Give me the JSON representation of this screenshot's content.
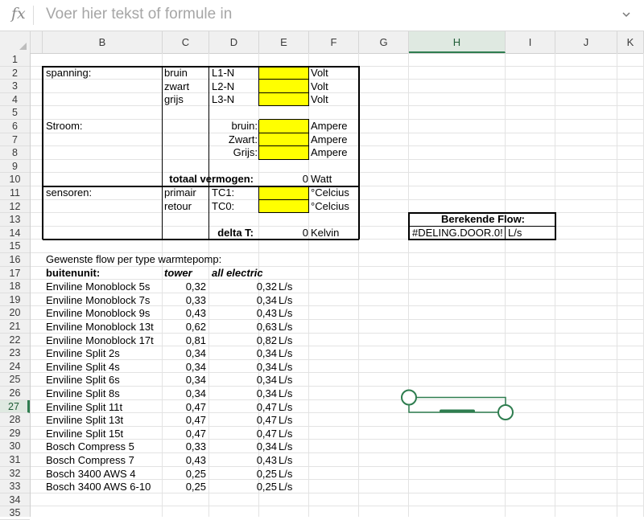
{
  "formula_bar": {
    "fx_label": "fx",
    "placeholder": "Voer hier tekst of formule in"
  },
  "columns": [
    "B",
    "C",
    "D",
    "E",
    "F",
    "G",
    "H",
    "I",
    "J",
    "K"
  ],
  "selected_column": "H",
  "selected_row": 27,
  "rows": [
    "1",
    "2",
    "3",
    "4",
    "5",
    "6",
    "7",
    "8",
    "9",
    "10",
    "11",
    "12",
    "13",
    "14",
    "15",
    "16",
    "17",
    "18",
    "19",
    "20",
    "21",
    "22",
    "23",
    "24",
    "25",
    "26",
    "27",
    "28",
    "29",
    "30",
    "31",
    "32",
    "33",
    "34",
    "35"
  ],
  "block": {
    "spanning": "spanning:",
    "bruin": "bruin",
    "zwart": "zwart",
    "grijs": "grijs",
    "l1n": "L1-N",
    "l2n": "L2-N",
    "l3n": "L3-N",
    "volt": "Volt",
    "stroom": "Stroom:",
    "bruin_c": "bruin:",
    "zwart_c": "Zwart:",
    "grijs_c": "Grijs:",
    "ampere": "Ampere",
    "totaal": "totaal vermogen:",
    "totaal_val": "0",
    "watt": "Watt",
    "sensoren": "sensoren:",
    "primair": "primair",
    "retour": "retour",
    "tc1": "TC1:",
    "tc0": "TC0:",
    "celcius": "°Celcius",
    "delta": "delta T:",
    "delta_val": "0",
    "kelvin": "Kelvin"
  },
  "flow_box": {
    "title": "Berekende Flow:",
    "value": "#DELING.DOOR.0!",
    "unit": "L/s"
  },
  "table": {
    "caption": "Gewenste flow per type warmtepomp:",
    "h_unit": "buitenunit:",
    "h_tower": "tower",
    "h_all": "all electric",
    "unit": "L/s",
    "rows": [
      {
        "name": "Enviline Monoblock 5s",
        "tower": "0,32",
        "all": "0,32"
      },
      {
        "name": "Enviline Monoblock 7s",
        "tower": "0,33",
        "all": "0,34"
      },
      {
        "name": "Enviline Monoblock 9s",
        "tower": "0,43",
        "all": "0,43"
      },
      {
        "name": "Enviline Monoblock 13t",
        "tower": "0,62",
        "all": "0,63"
      },
      {
        "name": "Enviline Monoblock 17t",
        "tower": "0,81",
        "all": "0,82"
      },
      {
        "name": "Enviline Split 2s",
        "tower": "0,34",
        "all": "0,34"
      },
      {
        "name": "Enviline Split 4s",
        "tower": "0,34",
        "all": "0,34"
      },
      {
        "name": "Enviline Split 6s",
        "tower": "0,34",
        "all": "0,34"
      },
      {
        "name": "Enviline Split 8s",
        "tower": "0,34",
        "all": "0,34"
      },
      {
        "name": "Enviline Split 11t",
        "tower": "0,47",
        "all": "0,47"
      },
      {
        "name": "Enviline Split 13t",
        "tower": "0,47",
        "all": "0,47"
      },
      {
        "name": "Enviline Split 15t",
        "tower": "0,47",
        "all": "0,47"
      },
      {
        "name": "Bosch Compress 5",
        "tower": "0,33",
        "all": "0,34"
      },
      {
        "name": "Bosch Compress 7",
        "tower": "0,43",
        "all": "0,43"
      },
      {
        "name": "Bosch 3400 AWS 4",
        "tower": "0,25",
        "all": "0,25"
      },
      {
        "name": "Bosch 3400 AWS 6-10",
        "tower": "0,25",
        "all": "0,25"
      }
    ]
  },
  "colors": {
    "accent": "#2e7d4f",
    "input_fill": "#ffff00",
    "header_bg": "#f0f0f0"
  }
}
